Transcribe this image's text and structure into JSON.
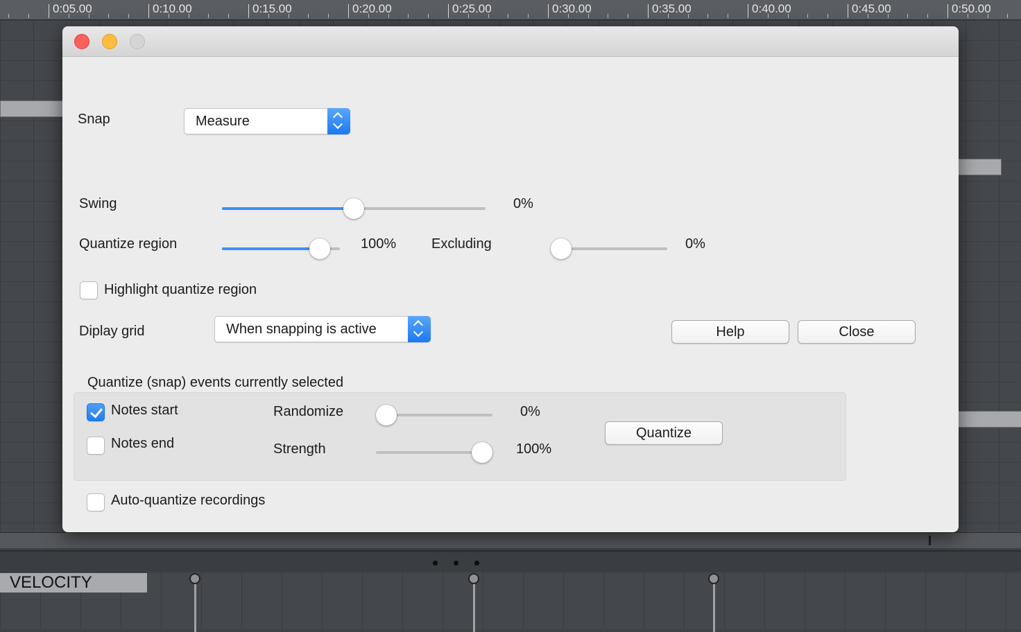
{
  "timeline": {
    "ticks": [
      "0:05.00",
      "0:10.00",
      "0:15.00",
      "0:20.00",
      "0:25.00",
      "0:30.00",
      "0:35.00",
      "0:40.00",
      "0:45.00",
      "0:50.00"
    ]
  },
  "velocity_lane": {
    "label": "VELOCITY"
  },
  "dialog": {
    "snap": {
      "label": "Snap",
      "value": "Measure"
    },
    "swing": {
      "label": "Swing",
      "value_text": "0%",
      "level": 0.5
    },
    "quantize_region": {
      "label": "Quantize region",
      "value_text": "100%",
      "level": 0.9
    },
    "excluding": {
      "label": "Excluding",
      "value_text": "0%",
      "level": 0.0
    },
    "highlight_region": {
      "label": "Highlight quantize region",
      "checked": false
    },
    "display_grid": {
      "label": "Diplay grid",
      "value": "When snapping is active"
    },
    "help_button": "Help",
    "close_button": "Close",
    "quantize_group": {
      "title": "Quantize (snap) events currently selected",
      "notes_start": {
        "label": "Notes start",
        "checked": true
      },
      "notes_end": {
        "label": "Notes end",
        "checked": false
      },
      "randomize": {
        "label": "Randomize",
        "value_text": "0%",
        "level": 0.0
      },
      "strength": {
        "label": "Strength",
        "value_text": "100%",
        "level": 1.0
      },
      "quantize_button": "Quantize"
    },
    "auto_quantize": {
      "label": "Auto-quantize recordings",
      "checked": false
    }
  },
  "colors": {
    "accent": "#3b8ff6",
    "close": "#fc605b",
    "minimize": "#fdbc40"
  }
}
